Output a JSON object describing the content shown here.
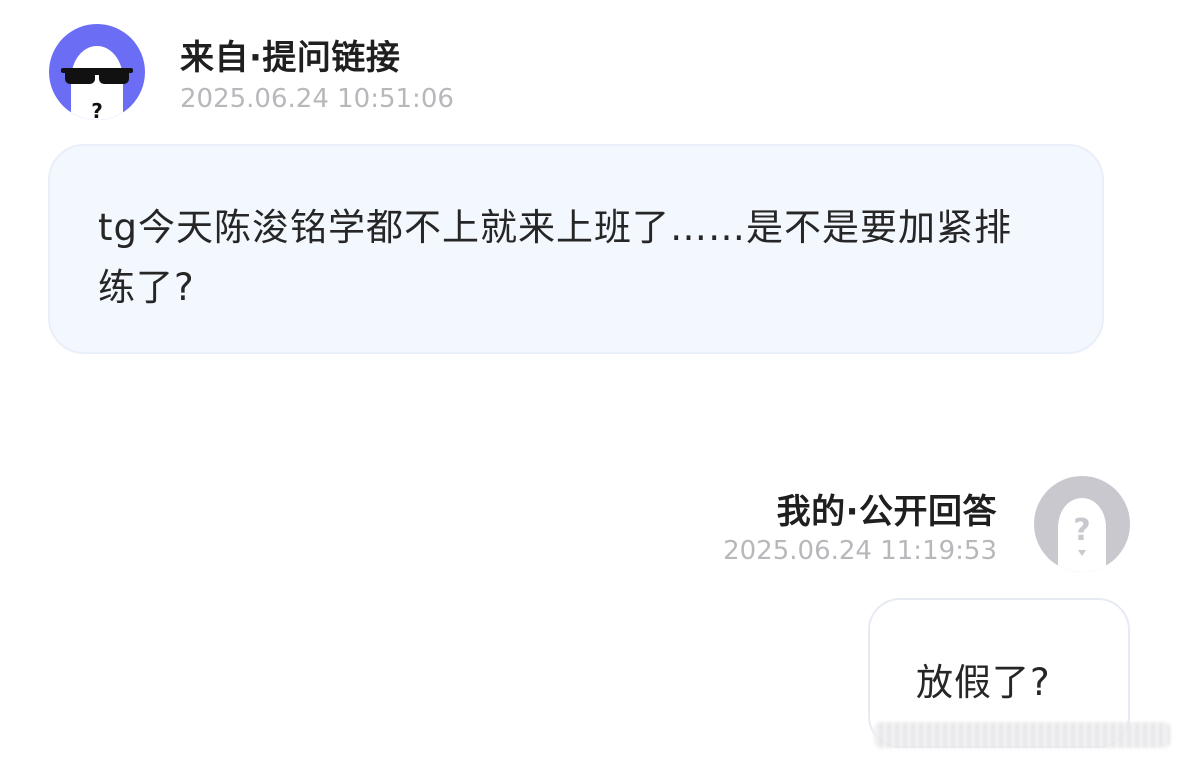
{
  "question": {
    "sender_label": "来自·提问链接",
    "timestamp": "2025.06.24 10:51:06",
    "avatar_icon": "sunglasses-ghost-avatar",
    "avatar_color": "#6b6ef5",
    "text": "tg今天陈浚铭学都不上就来上班了……是不是要加紧排练了?",
    "bubble_color": "#f3f7fe"
  },
  "answer": {
    "sender_label": "我的·公开回答",
    "timestamp": "2025.06.24 11:19:53",
    "avatar_icon": "question-mark-ghost-avatar",
    "avatar_color": "#c8c8ce",
    "text": "放假了?"
  },
  "colors": {
    "title_text": "#1f1f1f",
    "timestamp_text": "#b8b8bc",
    "body_text": "#262626"
  }
}
